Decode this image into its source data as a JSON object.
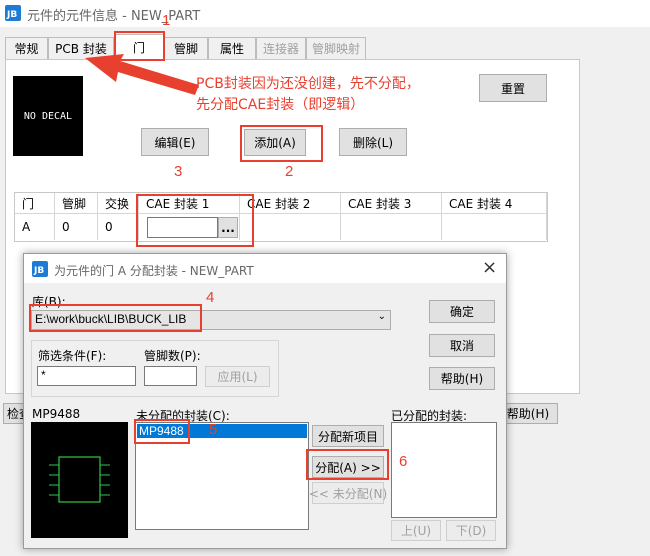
{
  "main_window": {
    "title": "元件的元件信息 - NEW_PART",
    "tabs": [
      {
        "label": "常规"
      },
      {
        "label": "PCB 封装"
      },
      {
        "label": "门"
      },
      {
        "label": "管脚"
      },
      {
        "label": "属性"
      },
      {
        "label": "连接器"
      },
      {
        "label": "管脚映射"
      }
    ],
    "decal_preview_text": "NO DECAL",
    "reset_label": "重置",
    "edit_label": "编辑(E)",
    "add_label": "添加(A)",
    "delete_label": "删除(L)",
    "annotation_text_line1": "PCB封装因为还没创建，先不分配，",
    "annotation_text_line2": "先分配CAE封装（即逻辑）",
    "table": {
      "headers": [
        "门",
        "管脚",
        "交换",
        "CAE 封装 1",
        "CAE 封装 2",
        "CAE 封装 3",
        "CAE 封装 4"
      ],
      "row": {
        "gate": "A",
        "pins": "0",
        "swap": "0",
        "cae1": "",
        "browse": "..."
      }
    },
    "partial_left_label": "检查",
    "partial_right_label": "帮助(H)"
  },
  "dialog": {
    "title": "为元件的门 A 分配封装 - NEW_PART",
    "close_glyph": "×",
    "library_label": "库(B):",
    "library_value": "E:\\work\\buck\\LIB\\BUCK_LIB",
    "ok_label": "确定",
    "cancel_label": "取消",
    "help_label": "帮助(H)",
    "filter_label": "筛选条件(F):",
    "filter_value": "*",
    "pincount_label": "管脚数(P):",
    "pincount_value": "",
    "apply_label": "应用(L)",
    "preview_name": "MP9488",
    "unassigned_label": "未分配的封装(C):",
    "unassigned_items": [
      "MP9488"
    ],
    "assign_new_label": "分配新项目",
    "assign_label": "分配(A) >>",
    "unassign_label": "<< 未分配(N)",
    "assigned_label": "已分配的封装:",
    "up_label": "上(U)",
    "down_label": "下(D)"
  },
  "markers": [
    "1",
    "2",
    "3",
    "4",
    "5",
    "6"
  ],
  "colors": {
    "annotation": "#e8402f",
    "selection": "#0078d7",
    "app_icon": "#1e7bd4"
  }
}
